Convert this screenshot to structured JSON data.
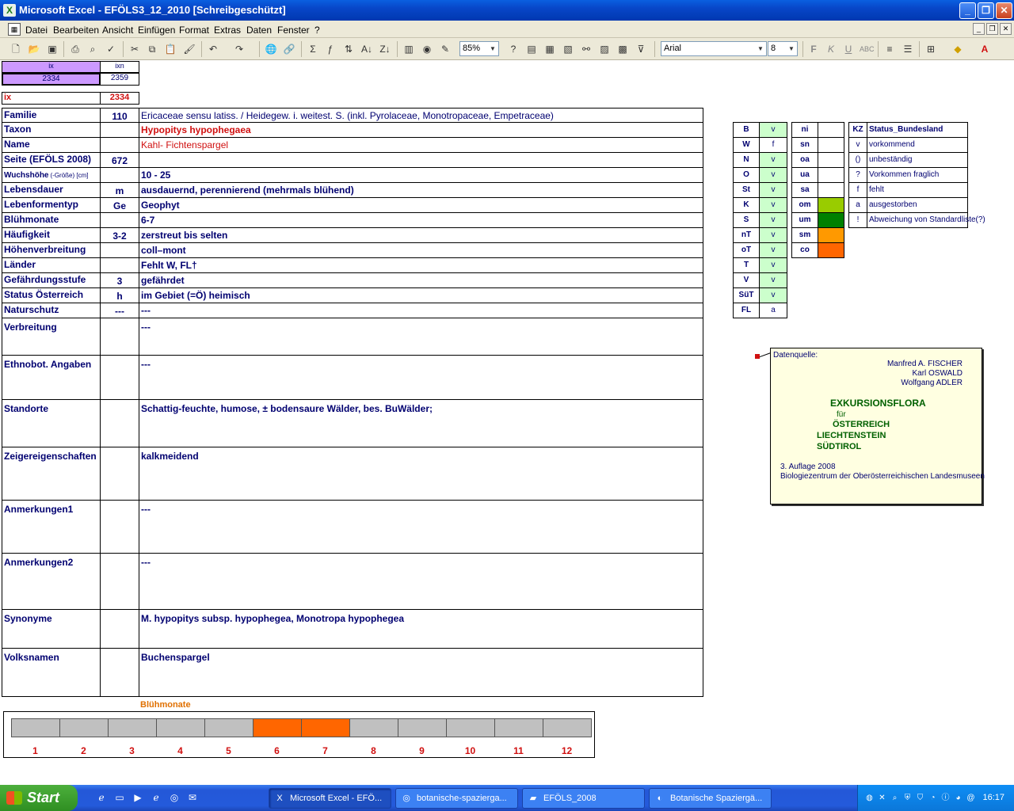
{
  "window": {
    "title": "Microsoft Excel - EFÖLS3_12_2010  [Schreibgeschützt]",
    "minimize": "_",
    "maximize": "❐",
    "close": "✕"
  },
  "menu": [
    "Datei",
    "Bearbeiten",
    "Ansicht",
    "Einfügen",
    "Format",
    "Extras",
    "Daten",
    "Fenster",
    "?"
  ],
  "doc_controls": {
    "min": "_",
    "restore": "❐",
    "close": "✕"
  },
  "toolbar": {
    "zoom": "85%",
    "font": "Arial",
    "size": "8",
    "bold": "F",
    "italic": "K",
    "underline": "U"
  },
  "top_cells": {
    "ix_header": "ix",
    "ixn_header": "ixn",
    "ix_value": "2334",
    "ixn_value": "2359",
    "ix_label": "ix",
    "ix_main": "2334"
  },
  "rows": [
    {
      "label": "Familie",
      "code": "110",
      "text": "Ericaceae sensu latiss.  /  Heidegew. i. weitest. S. (inkl. Pyrolaceae, Monotropaceae, Empetraceae)"
    },
    {
      "label": "Taxon",
      "code": "",
      "text": "Hypopitys hypophegaea"
    },
    {
      "label": "Name",
      "code": "",
      "text": "Kahl- Fichtenspargel"
    },
    {
      "label": "Seite (EFÖLS 2008)",
      "code": "672",
      "text": ""
    },
    {
      "label": "Wuchshöhe",
      "label_small": "(-Größe) [cm]",
      "code": "",
      "text": " 10 - 25"
    },
    {
      "label": "Lebensdauer",
      "code": "m",
      "text": "ausdauernd, perennierend (mehrmals blühend)"
    },
    {
      "label": "Lebenformentyp",
      "code": "Ge",
      "text": "Geophyt"
    },
    {
      "label": "Blühmonate",
      "code": "",
      "text": " 6-7"
    },
    {
      "label": "Häufigkeit",
      "code": "3-2",
      "text": "zerstreut bis selten"
    },
    {
      "label": "Höhenverbreitung",
      "code": "",
      "text": "coll–mont"
    },
    {
      "label": "Länder",
      "code": "",
      "text": "Fehlt W, FL†"
    },
    {
      "label": "Gefährdungsstufe",
      "code": "3",
      "text": "gefährdet"
    },
    {
      "label": "Status Österreich",
      "code": "h",
      "text": "im Gebiet (=Ö) heimisch"
    },
    {
      "label": "Naturschutz",
      "code": "---",
      "text": " ---"
    }
  ],
  "tall_rows": [
    {
      "label": "Verbreitung",
      "text": " ---"
    },
    {
      "label": "Ethnobot. Angaben",
      "text": "---"
    },
    {
      "label": "Standorte",
      "text": "Schattig-feuchte, humose, ± bodensaure Wälder, bes. BuWälder;"
    },
    {
      "label": "Zeigereigenschaften",
      "text": "kalkmeidend"
    },
    {
      "label": "Anmerkungen1",
      "text": "---"
    },
    {
      "label": "Anmerkungen2",
      "text": "---"
    },
    {
      "label": "Synonyme",
      "text": "M. hypopitys subsp. hypophegea, Monotropa hypophegea"
    },
    {
      "label": "Volksnamen",
      "text": "Buchenspargel"
    }
  ],
  "states": [
    {
      "k": "B",
      "v": "v"
    },
    {
      "k": "W",
      "v": "f"
    },
    {
      "k": "N",
      "v": "v"
    },
    {
      "k": "O",
      "v": "v"
    },
    {
      "k": "St",
      "v": "v"
    },
    {
      "k": "K",
      "v": "v"
    },
    {
      "k": "S",
      "v": "v"
    },
    {
      "k": "nT",
      "v": "v"
    },
    {
      "k": "oT",
      "v": "v"
    },
    {
      "k": "T",
      "v": "v"
    },
    {
      "k": "V",
      "v": "v"
    },
    {
      "k": "SüT",
      "v": "v"
    },
    {
      "k": "FL",
      "v": "a"
    }
  ],
  "zones": [
    {
      "k": "ni",
      "color": ""
    },
    {
      "k": "sn",
      "color": ""
    },
    {
      "k": "oa",
      "color": ""
    },
    {
      "k": "ua",
      "color": ""
    },
    {
      "k": "sa",
      "color": ""
    },
    {
      "k": "om",
      "color": "#99cc00"
    },
    {
      "k": "um",
      "color": "#008000"
    },
    {
      "k": "sm",
      "color": "#ff9900"
    },
    {
      "k": "co",
      "color": "#ff6600"
    }
  ],
  "legend": {
    "header_k": "KZ",
    "header_v": "Status_Bundesland",
    "items": [
      {
        "k": "v",
        "v": "vorkommend"
      },
      {
        "k": "()",
        "v": "unbeständig"
      },
      {
        "k": "?",
        "v": "Vorkommen fraglich"
      },
      {
        "k": "f",
        "v": "fehlt"
      },
      {
        "k": "a",
        "v": "ausgestorben"
      },
      {
        "k": "!",
        "v": "Abweichung von Standardliste(?)"
      }
    ]
  },
  "note": {
    "src": "Datenquelle:",
    "a1": "Manfred A. FISCHER",
    "a2": "Karl OSWALD",
    "a3": "Wolfgang ADLER",
    "t1": "EXKURSIONSFLORA",
    "t2": "für",
    "t3": "ÖSTERREICH",
    "t4": "LIECHTENSTEIN",
    "t5": "SÜDTIROL",
    "e1": "3. Auflage 2008",
    "e2": "Biologiezentrum der Oberösterreichischen Landesmuseen"
  },
  "months": {
    "title": "Blühmonate",
    "labels": [
      "1",
      "2",
      "3",
      "4",
      "5",
      "6",
      "7",
      "8",
      "9",
      "10",
      "11",
      "12"
    ],
    "active": [
      6,
      7
    ],
    "active_color": "#ff6600",
    "inactive_color": "#c0c0c0"
  },
  "taskbar": {
    "start": "Start",
    "tasks": [
      "Microsoft Excel - EFÖ...",
      "botanische-spazierga...",
      "EFÖLS_2008",
      "Botanische Spaziergä..."
    ],
    "clock": "16:17"
  }
}
